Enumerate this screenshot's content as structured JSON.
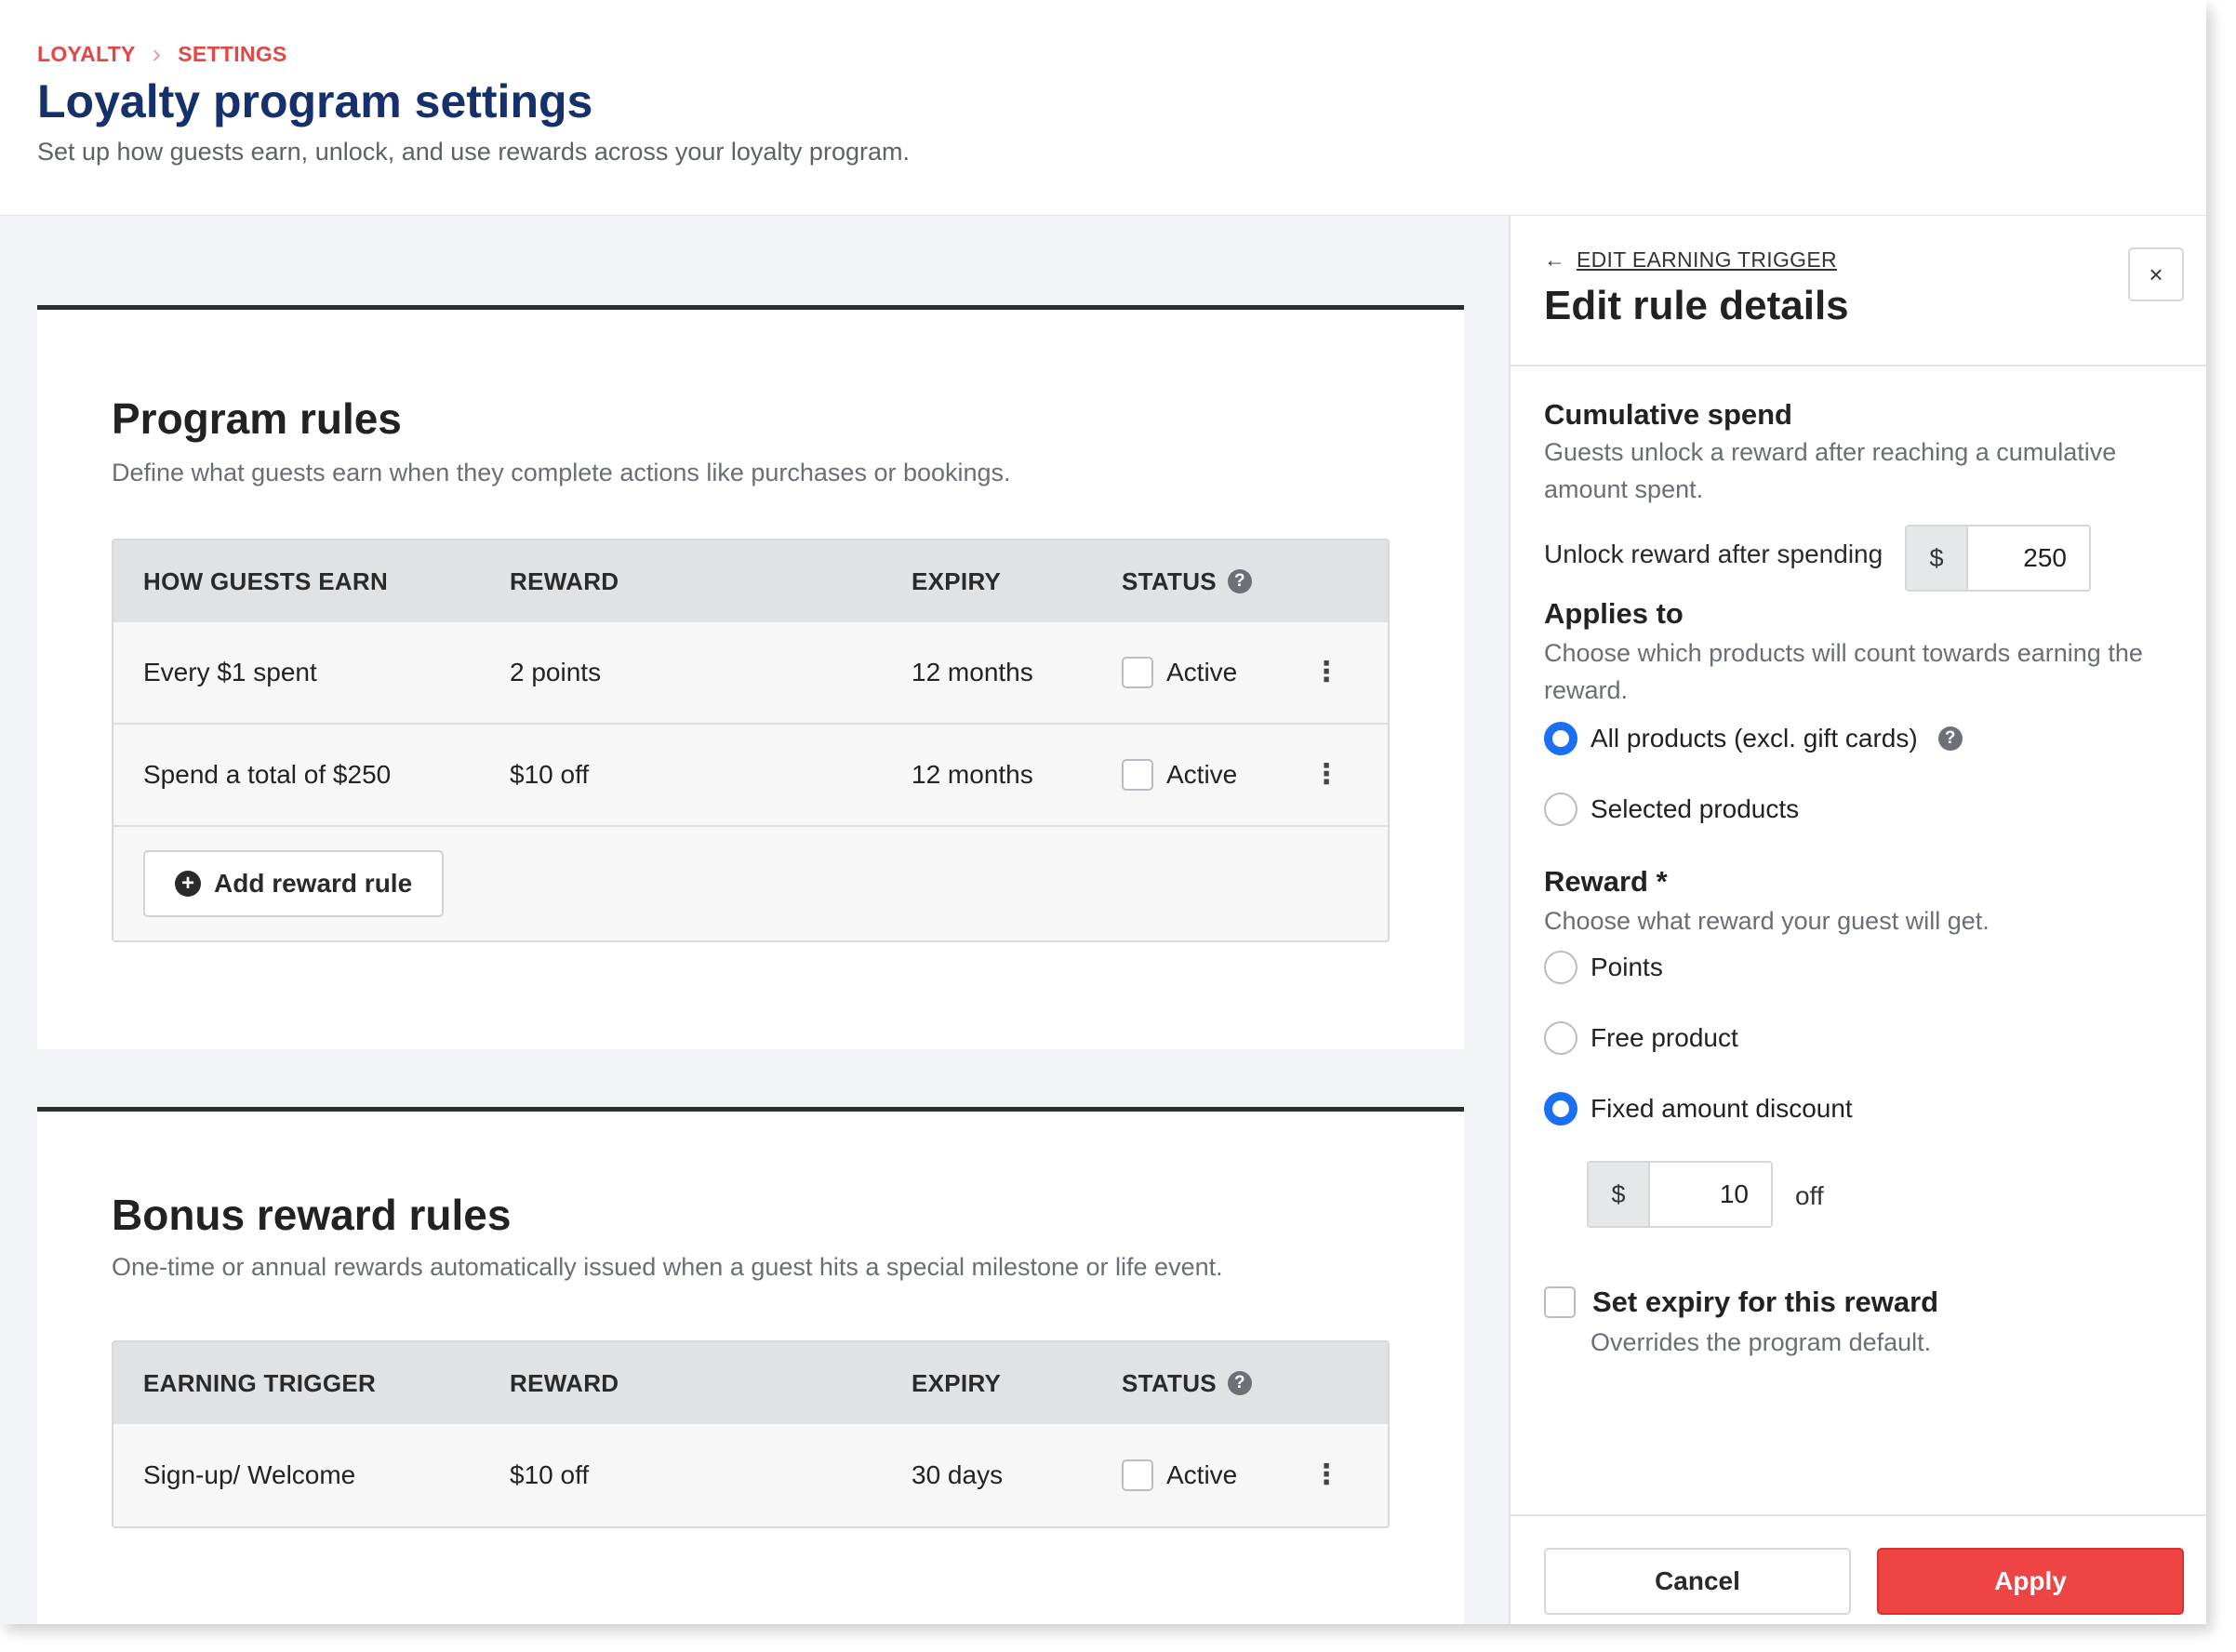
{
  "breadcrumb": {
    "items": [
      "LOYALTY",
      "SETTINGS"
    ]
  },
  "header": {
    "title": "Loyalty program settings",
    "subtitle": "Set up how guests earn, unlock, and use rewards across your loyalty program."
  },
  "program_rules": {
    "title": "Program rules",
    "subtitle": "Define what guests earn when they complete actions like purchases or bookings.",
    "columns": [
      "HOW GUESTS EARN",
      "REWARD",
      "EXPIRY",
      "STATUS"
    ],
    "rows": [
      {
        "earn": "Every $1 spent",
        "reward": "2 points",
        "expiry": "12 months",
        "status": "Active"
      },
      {
        "earn": "Spend a total of $250",
        "reward": "$10 off",
        "expiry": "12 months",
        "status": "Active"
      }
    ],
    "add_button": "Add reward rule"
  },
  "bonus_rules": {
    "title": "Bonus reward rules",
    "subtitle": "One-time or annual rewards automatically issued when a guest hits a special milestone or life event.",
    "columns": [
      "EARNING TRIGGER",
      "REWARD",
      "EXPIRY",
      "STATUS"
    ],
    "rows": [
      {
        "earn": "Sign-up/ Welcome",
        "reward": "$10 off",
        "expiry": "30 days",
        "status": "Active"
      }
    ]
  },
  "panel": {
    "back_link": "EDIT EARNING TRIGGER",
    "title": "Edit rule details",
    "close_symbol": "×",
    "cumulative": {
      "title": "Cumulative spend",
      "desc": "Guests unlock a reward after reaching a cumulative amount spent.",
      "unlock_label": "Unlock reward after spending",
      "currency": "$",
      "amount": "250"
    },
    "applies_to": {
      "title": "Applies to",
      "desc": "Choose which products will count towards earning the reward.",
      "options": [
        "All products (excl. gift cards)",
        "Selected products"
      ],
      "selected": "All products (excl. gift cards)"
    },
    "reward": {
      "title": "Reward *",
      "desc": "Choose what reward your guest will get.",
      "options": [
        "Points",
        "Free product",
        "Fixed amount discount"
      ],
      "selected": "Fixed amount discount",
      "currency": "$",
      "amount": "10",
      "suffix": "off"
    },
    "expiry": {
      "label": "Set expiry for this reward",
      "desc": "Overrides the program default.",
      "checked": false
    },
    "cancel_label": "Cancel",
    "apply_label": "Apply"
  },
  "colors": {
    "brand_navy": "#15306b",
    "breadcrumb_red": "#e24646",
    "apply_red": "#ef4444",
    "radio_blue": "#1a6ff2"
  },
  "icons": {
    "help": "help-circle-icon",
    "kebab": "more-vertical-icon",
    "plus": "plus-circle-icon",
    "back": "arrow-left-icon",
    "close": "close-icon",
    "chevron": "chevron-right-icon"
  }
}
